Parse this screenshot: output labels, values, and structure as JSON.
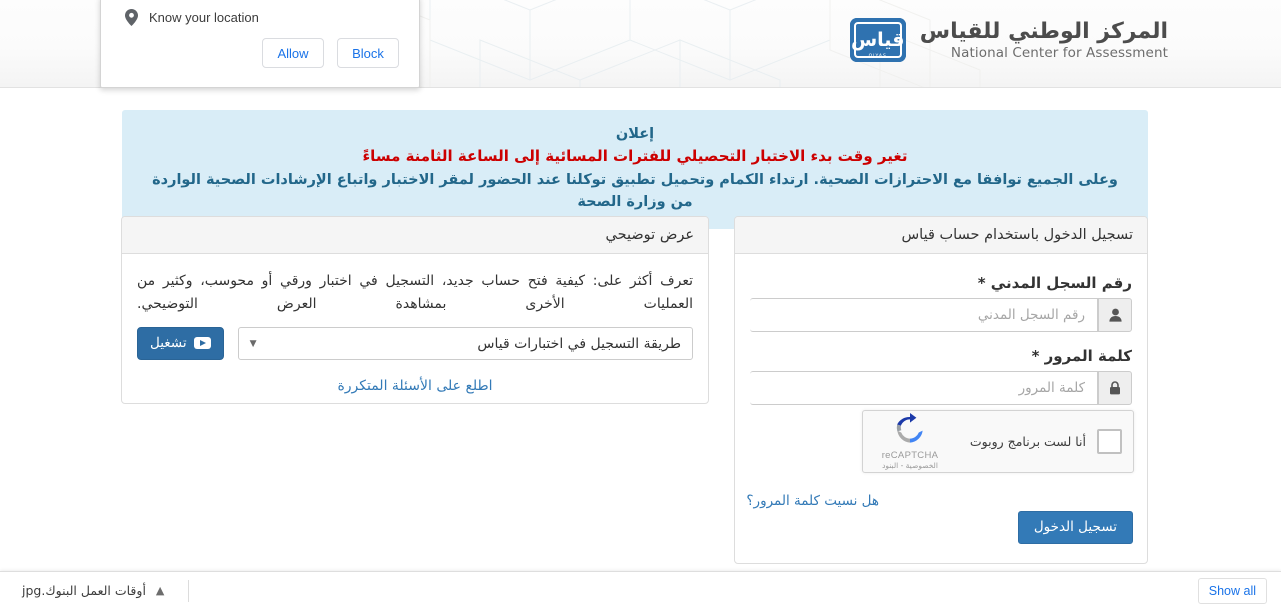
{
  "header": {
    "brand_ar": "المركز الوطني للقياس",
    "brand_en": "National Center for Assessment",
    "logo_glyph": "قياس",
    "logo_sub": "QIYAS"
  },
  "geo_permission": {
    "message": "Know your location",
    "allow_label": "Allow",
    "block_label": "Block",
    "icon": "location-pin-icon"
  },
  "announcement": {
    "title": "إعلان",
    "line_red": "تغير وقت بدء الاختبار التحصيلي للفترات المسائية إلى الساعة الثامنة مساءً",
    "line_blue": "وعلى الجميع توافقا مع الاحترازات الصحية. ارتداء الكمام وتحميل تطبيق توكلنا عند الحضور لمقر الاختبار واتباع الإرشادات الصحية الواردة من وزارة الصحة",
    "bg_color": "#d9edf7",
    "red_color": "#cc0000",
    "blue_color": "#22678a"
  },
  "login_panel": {
    "title": "تسجيل الدخول باستخدام حساب قياس",
    "id_label": "رقم السجل المدني *",
    "id_placeholder": "رقم السجل المدني",
    "id_value": "",
    "id_icon": "user-icon",
    "password_label": "كلمة المرور *",
    "password_placeholder": "كلمة المرور",
    "password_value": "",
    "password_icon": "lock-icon",
    "forgot_label": "هل نسيت كلمة المرور؟",
    "submit_label": "تسجيل الدخول",
    "submit_color": "#337ab7"
  },
  "recaptcha": {
    "label": "أنا لست برنامج روبوت",
    "brand": "reCAPTCHA",
    "terms": "الخصوصية - البنود",
    "checked": false
  },
  "demo_panel": {
    "title": "عرض توضيحي",
    "description": "تعرف أكثر على: كيفية فتح حساب جديد، التسجيل في اختبار ورقي أو محوسب، وكثير من العمليات الأخرى بمشاهدة العرض التوضيحي.",
    "select_value": "طريقة التسجيل في اختبارات قياس",
    "play_label": "تشغيل",
    "play_icon": "youtube-play-icon",
    "faq_label": "اطلع على الأسئلة المتكررة"
  },
  "download_bar": {
    "file_name": "أوقات العمل البنوك.jpg",
    "caret_icon": "chevron-up-icon",
    "show_all_label": "Show all"
  }
}
